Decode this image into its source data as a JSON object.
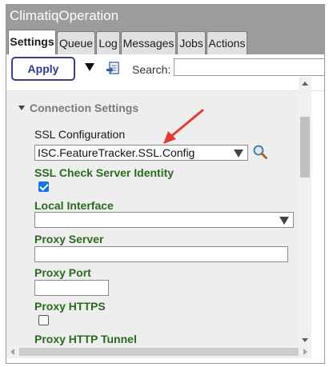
{
  "window": {
    "title": "ClimatiqOperation"
  },
  "tabs": [
    {
      "label": "Settings",
      "active": true
    },
    {
      "label": "Queue"
    },
    {
      "label": "Log"
    },
    {
      "label": "Messages"
    },
    {
      "label": "Jobs"
    },
    {
      "label": "Actions"
    }
  ],
  "toolbar": {
    "apply_label": "Apply",
    "search_label": "Search:",
    "search_value": ""
  },
  "section": {
    "title": "Connection Settings",
    "fields": {
      "ssl_config": {
        "label": "SSL Configuration",
        "value": "ISC.FeatureTracker.SSL.Config"
      },
      "ssl_check": {
        "label": "SSL Check Server Identity",
        "checked": true
      },
      "local_interface": {
        "label": "Local Interface",
        "value": ""
      },
      "proxy_server": {
        "label": "Proxy Server",
        "value": ""
      },
      "proxy_port": {
        "label": "Proxy Port",
        "value": ""
      },
      "proxy_https": {
        "label": "Proxy HTTPS",
        "checked": false
      },
      "proxy_http_tunnel": {
        "label": "Proxy HTTP Tunnel",
        "checked": false
      }
    }
  },
  "colors": {
    "title_bar": "#9c9c9c",
    "field_label_green": "#2a6a1f",
    "apply_border": "#3a3f8f",
    "annotation_arrow": "#e53935"
  },
  "icons": [
    "dropdown-arrow-icon",
    "document-icon",
    "magnifier-icon",
    "collapse-triangle-icon",
    "annotation-arrow-icon"
  ]
}
